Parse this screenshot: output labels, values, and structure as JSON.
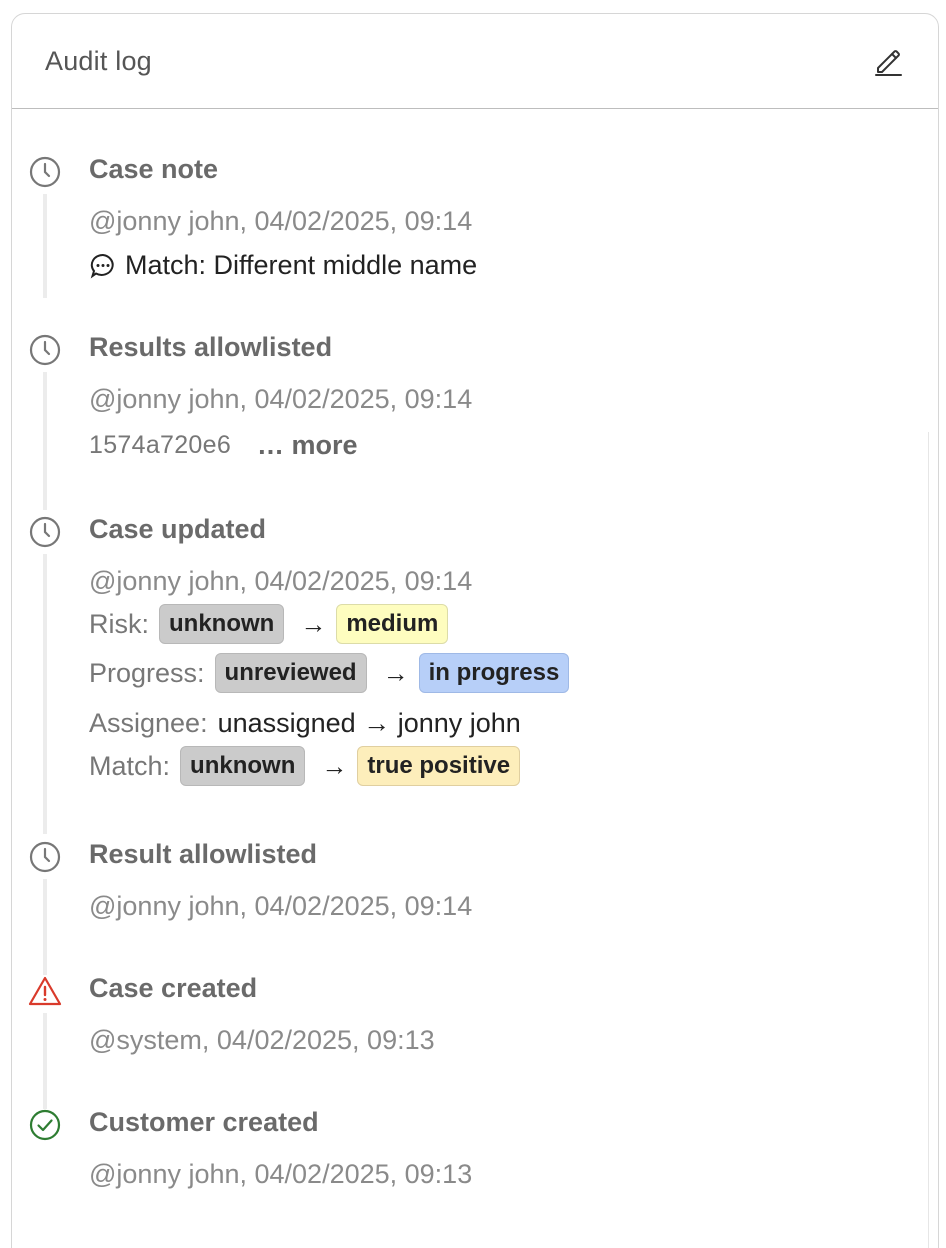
{
  "header": {
    "title": "Audit log",
    "edit_icon": "pencil-icon"
  },
  "entries": [
    {
      "title": "Case note",
      "meta": "@jonny john, 04/02/2025, 09:14",
      "note": "Match: Different middle name",
      "icon": "clock-icon"
    },
    {
      "title": "Results allowlisted",
      "meta": "@jonny john, 04/02/2025, 09:14",
      "hash": "1574a720e6",
      "more_label": "… more",
      "icon": "clock-icon"
    },
    {
      "title": "Case updated",
      "meta": "@jonny john, 04/02/2025, 09:14",
      "icon": "clock-icon",
      "changes": {
        "risk": {
          "label": "Risk:",
          "from": "unknown",
          "to": "medium"
        },
        "progress": {
          "label": "Progress:",
          "from": "unreviewed",
          "to": "in progress"
        },
        "assignee": {
          "label": "Assignee:",
          "text": "unassigned → jonny john"
        },
        "match": {
          "label": "Match:",
          "from": "unknown",
          "to": "true positive"
        }
      }
    },
    {
      "title": "Result allowlisted",
      "meta": "@jonny john, 04/02/2025, 09:14",
      "icon": "clock-icon"
    },
    {
      "title": "Case created",
      "meta": "@system, 04/02/2025, 09:13",
      "icon": "warning-icon"
    },
    {
      "title": "Customer created",
      "meta": "@jonny john, 04/02/2025, 09:13",
      "icon": "check-circle-icon"
    }
  ],
  "colors": {
    "warning": "#d93a2b",
    "success": "#2e7d32",
    "chip_grey": "#cbcbcb",
    "chip_yellow": "#fefdbf",
    "chip_blue": "#b7cff8",
    "chip_amber": "#fdeebb"
  }
}
